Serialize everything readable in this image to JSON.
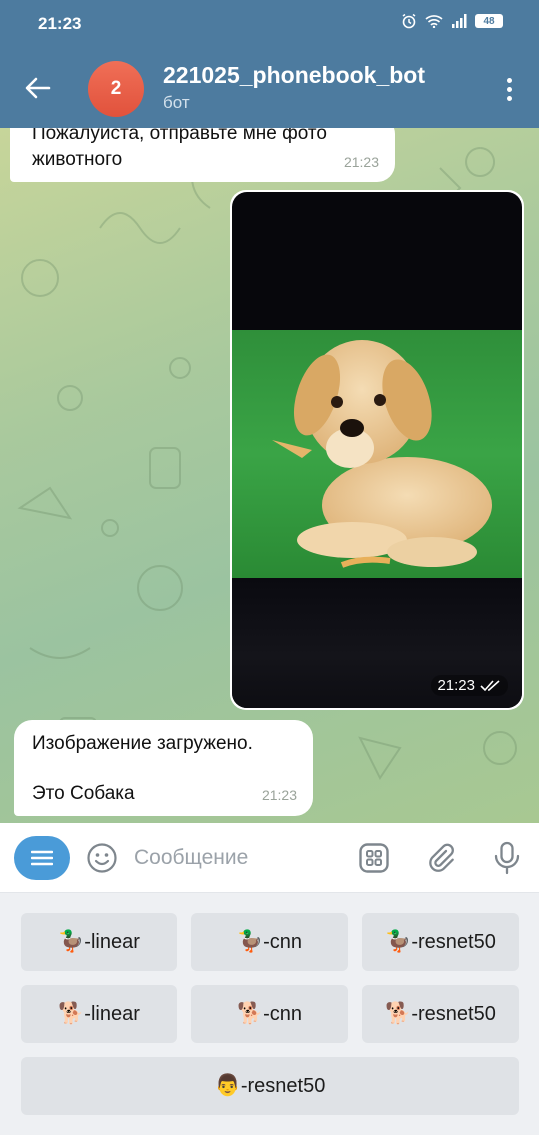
{
  "status_bar": {
    "time": "21:23",
    "battery": "48"
  },
  "header": {
    "avatar_text": "2",
    "title": "221025_phonebook_bot",
    "subtitle": "бот"
  },
  "messages": {
    "incoming_1": {
      "text": "Пожалуйста, отправьте мне фото животного",
      "time": "21:23"
    },
    "outgoing_photo": {
      "time": "21:23",
      "status": "read"
    },
    "incoming_2": {
      "line1": "Изображение загружено.",
      "line2": "Это Собака",
      "time": "21:23"
    }
  },
  "composer": {
    "placeholder": "Сообщение"
  },
  "keyboard": {
    "row1": [
      {
        "emoji": "🦆",
        "label": "-linear"
      },
      {
        "emoji": "🦆",
        "label": "-cnn"
      },
      {
        "emoji": "🦆",
        "label": "-resnet50"
      }
    ],
    "row2": [
      {
        "emoji": "🐕",
        "label": "-linear"
      },
      {
        "emoji": "🐕",
        "label": "-cnn"
      },
      {
        "emoji": "🐕",
        "label": "-resnet50"
      }
    ],
    "row3": [
      {
        "emoji": "👨",
        "label": "-resnet50"
      }
    ]
  },
  "colors": {
    "header": "#4d7b9f",
    "accent": "#4a9bd8",
    "avatar": "#e8604a"
  }
}
